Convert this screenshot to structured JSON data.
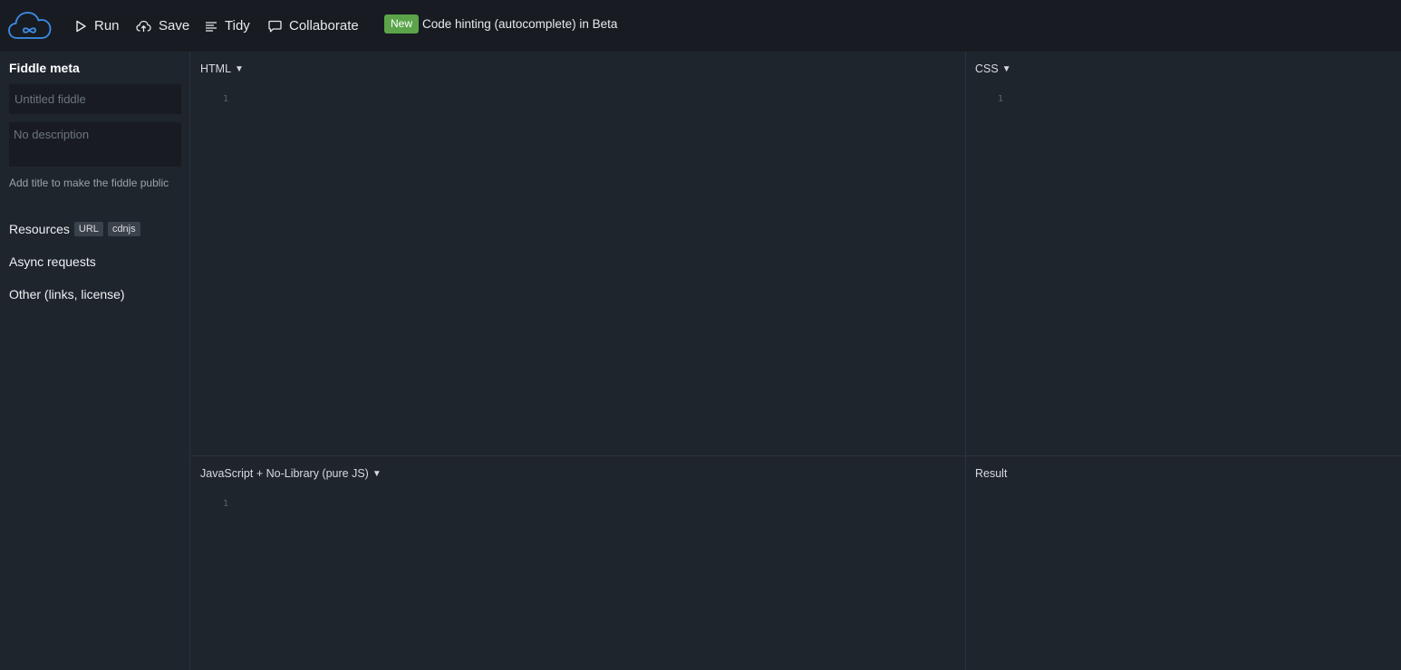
{
  "toolbar": {
    "run_label": "Run",
    "save_label": "Save",
    "tidy_label": "Tidy",
    "collaborate_label": "Collaborate",
    "badge": "New",
    "announcement": "Code hinting (autocomplete) in Beta"
  },
  "sidebar": {
    "title": "Fiddle meta",
    "title_placeholder": "Untitled fiddle",
    "description_placeholder": "No description",
    "hint": "Add title to make the fiddle public",
    "resources_label": "Resources",
    "resources_chips": [
      "URL",
      "cdnjs"
    ],
    "async_label": "Async requests",
    "other_label": "Other (links, license)"
  },
  "panes": {
    "html": {
      "label": "HTML",
      "line": "1"
    },
    "css": {
      "label": "CSS",
      "line": "1"
    },
    "js": {
      "label": "JavaScript + No-Library (pure JS)",
      "line": "1"
    },
    "result": {
      "label": "Result"
    }
  },
  "colors": {
    "background": "#1f252d",
    "topbar": "#181c22",
    "accent_blue": "#3d8eea",
    "badge_green": "#5ba44a"
  }
}
